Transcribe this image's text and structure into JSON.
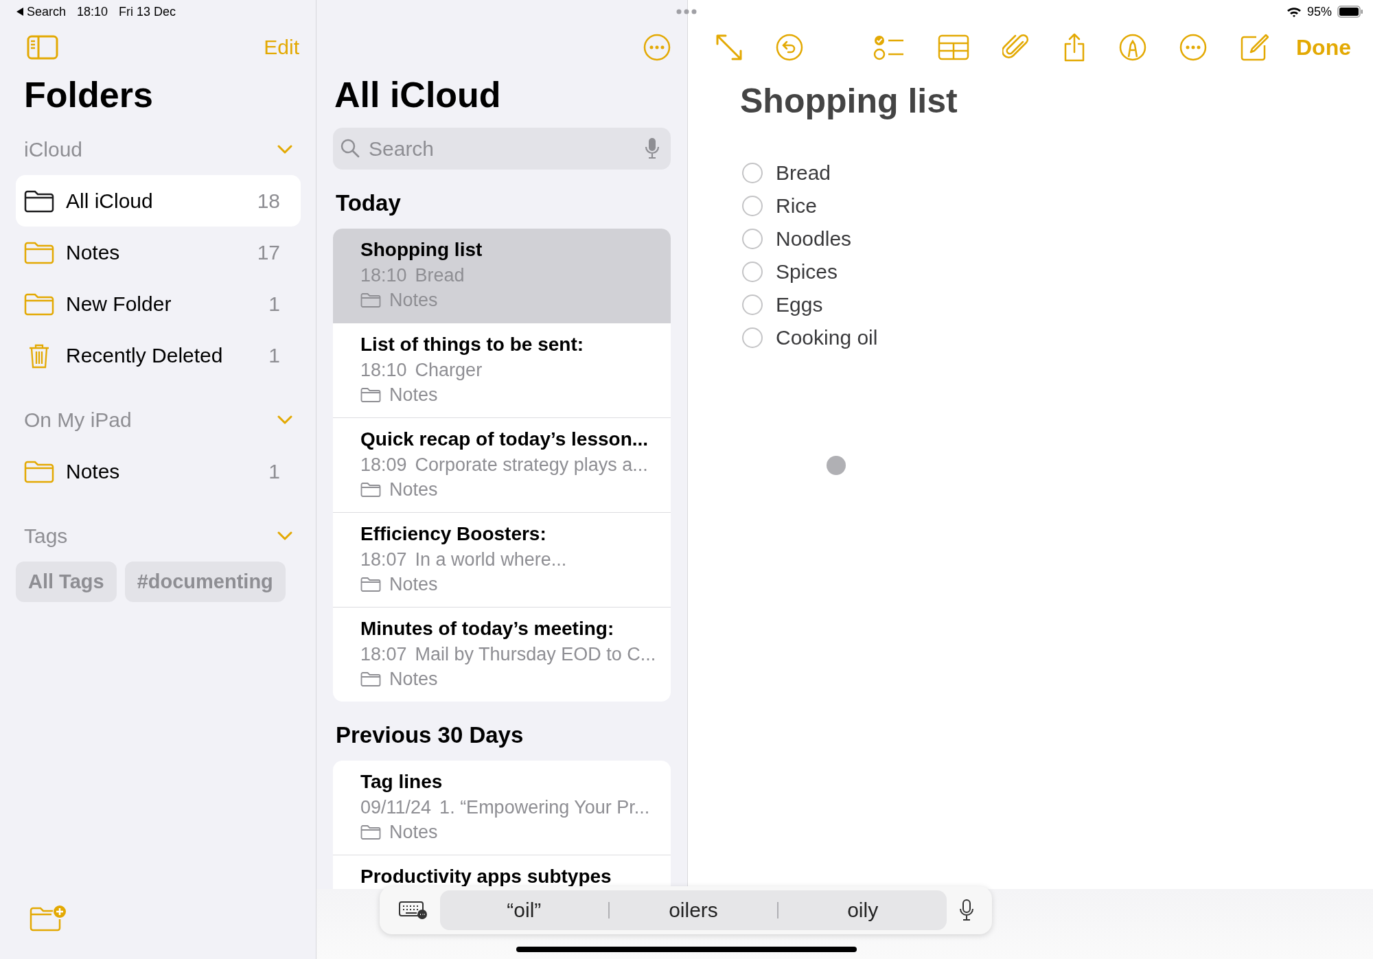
{
  "status_bar": {
    "back_label": "Search",
    "time": "18:10",
    "date": "Fri 13 Dec",
    "battery_text": "95%"
  },
  "sidebar": {
    "edit": "Edit",
    "title": "Folders",
    "sections": [
      {
        "kind": "folders",
        "title": "iCloud",
        "expanded": true,
        "items": [
          {
            "kind": "folder",
            "name": "All iCloud",
            "count": "18",
            "selected": true
          },
          {
            "kind": "folder",
            "name": "Notes",
            "count": "17",
            "selected": false
          },
          {
            "kind": "folder",
            "name": "New Folder",
            "count": "1",
            "selected": false
          },
          {
            "kind": "trash",
            "name": "Recently Deleted",
            "count": "1",
            "selected": false
          }
        ]
      },
      {
        "kind": "folders",
        "title": "On My iPad",
        "expanded": true,
        "items": [
          {
            "kind": "folder",
            "name": "Notes",
            "count": "1",
            "selected": false
          }
        ]
      },
      {
        "kind": "tags",
        "title": "Tags",
        "expanded": true,
        "chips": [
          "All Tags",
          "#documenting"
        ]
      }
    ]
  },
  "list": {
    "title": "All iCloud",
    "search": {
      "placeholder": "Search"
    },
    "groups": [
      {
        "title": "Today",
        "notes": [
          {
            "title": "Shopping list",
            "time": "18:10",
            "preview": "Bread",
            "folder": "Notes",
            "selected": true
          },
          {
            "title": "List of things to be sent:",
            "time": "18:10",
            "preview": "Charger",
            "folder": "Notes",
            "selected": false
          },
          {
            "title": "Quick recap of today’s lesson...",
            "time": "18:09",
            "preview": "Corporate strategy plays a...",
            "folder": "Notes",
            "selected": false
          },
          {
            "title": "Efficiency Boosters:",
            "time": "18:07",
            "preview": "In a world where...",
            "folder": "Notes",
            "selected": false
          },
          {
            "title": "Minutes of today’s meeting:",
            "time": "18:07",
            "preview": "Mail by Thursday EOD to C...",
            "folder": "Notes",
            "selected": false
          }
        ]
      },
      {
        "title": "Previous 30 Days",
        "notes": [
          {
            "title": "Tag lines",
            "time": "09/11/24",
            "preview": "1. “Empowering Your Pr...",
            "folder": "Notes",
            "selected": false
          },
          {
            "title": "Productivity apps subtypes",
            "selected": false
          }
        ]
      }
    ]
  },
  "note": {
    "done": "Done",
    "title": "Shopping list",
    "items": [
      {
        "text": "Bread",
        "checked": false
      },
      {
        "text": "Rice",
        "checked": false
      },
      {
        "text": "Noodles",
        "checked": false
      },
      {
        "text": "Spices",
        "checked": false
      },
      {
        "text": "Eggs",
        "checked": false
      },
      {
        "text": "Cooking oil",
        "checked": false
      }
    ]
  },
  "keyboard": {
    "suggestions": [
      "“oil”",
      "oilers",
      "oily"
    ]
  }
}
